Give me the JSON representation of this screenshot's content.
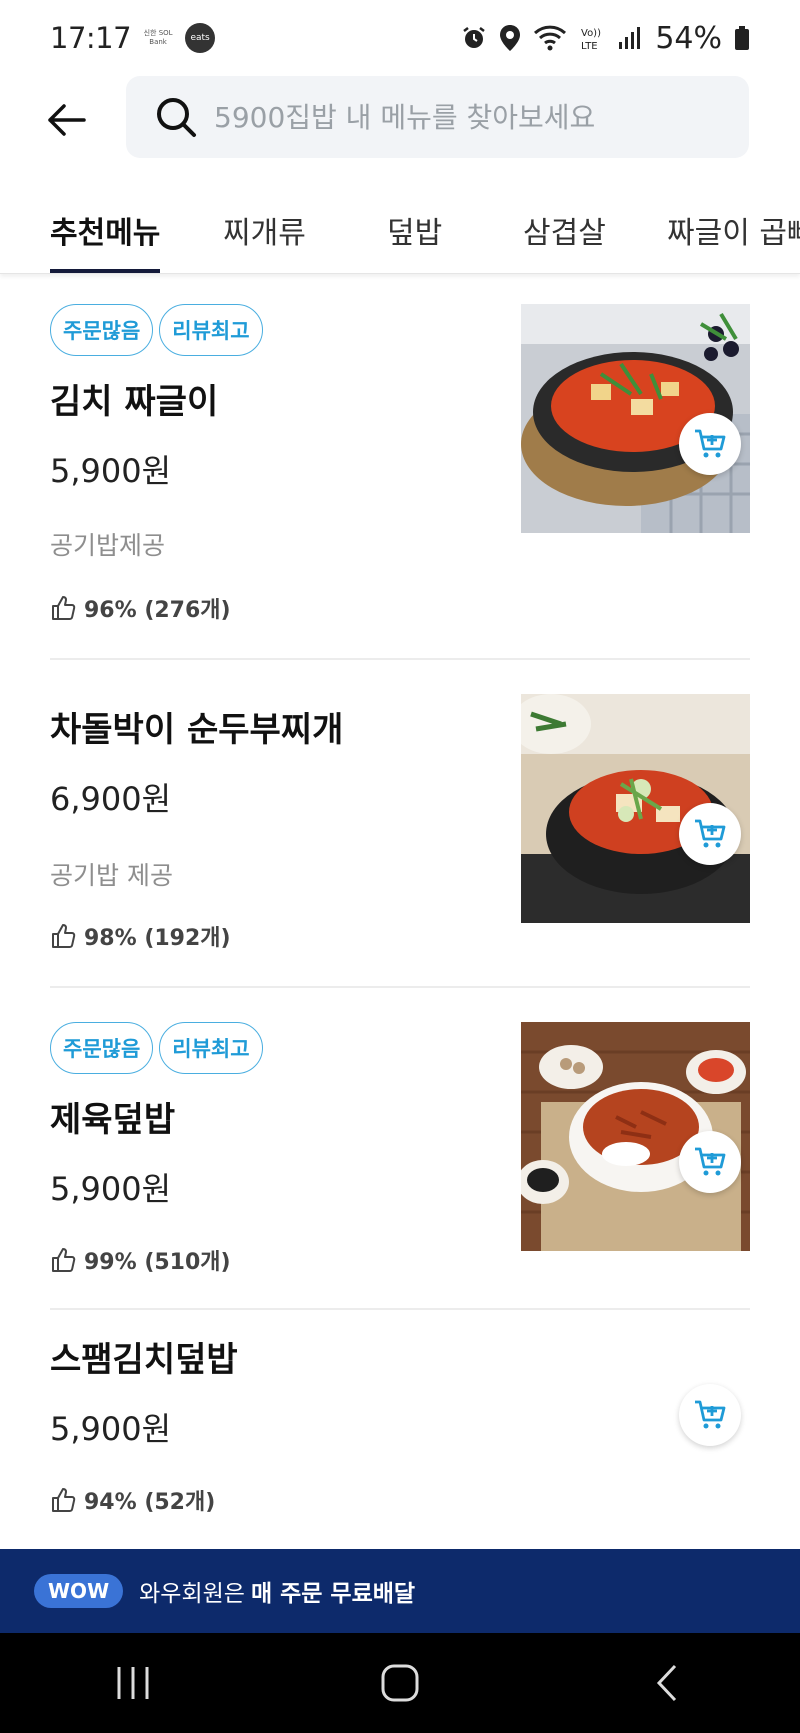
{
  "status_bar": {
    "time": "17:17",
    "bank_label": "신한 SOL Bank",
    "eats_label": "eats",
    "battery": "54%",
    "icons": [
      "alarm-icon",
      "location-icon",
      "wifi-icon",
      "volte-icon",
      "signal-icon",
      "battery-icon"
    ]
  },
  "search": {
    "placeholder": "5900집밥 내 메뉴를 찾아보세요"
  },
  "tabs": [
    {
      "label": "추천메뉴",
      "active": true
    },
    {
      "label": "찌개류",
      "active": false
    },
    {
      "label": "덮밥",
      "active": false
    },
    {
      "label": "삼겹살",
      "active": false
    },
    {
      "label": "짜글이 곱빼기",
      "active": false
    }
  ],
  "menu": {
    "items": [
      {
        "badges": [
          "주문많음",
          "리뷰최고"
        ],
        "name": "김치 짜글이",
        "price": "5,900원",
        "description": "공기밥제공",
        "rating": "96% (276개)",
        "has_image": true
      },
      {
        "badges": [],
        "name": "차돌박이 순두부찌개",
        "price": "6,900원",
        "description": "공기밥 제공",
        "rating": "98% (192개)",
        "has_image": true
      },
      {
        "badges": [
          "주문많음",
          "리뷰최고"
        ],
        "name": "제육덮밥",
        "price": "5,900원",
        "description": "",
        "rating": "99% (510개)",
        "has_image": true
      },
      {
        "badges": [],
        "name": "스팸김치덮밥",
        "price": "5,900원",
        "description": "",
        "rating": "94% (52개)",
        "has_image": false
      }
    ]
  },
  "wow_banner": {
    "pill": "WOW",
    "text": "와우회원은",
    "text_strong": "매 주문 무료배달"
  },
  "colors": {
    "accent_blue": "#1f9bd7",
    "tab_indicator": "#141a3a",
    "wow_banner_bg": "#0d2a6b"
  }
}
